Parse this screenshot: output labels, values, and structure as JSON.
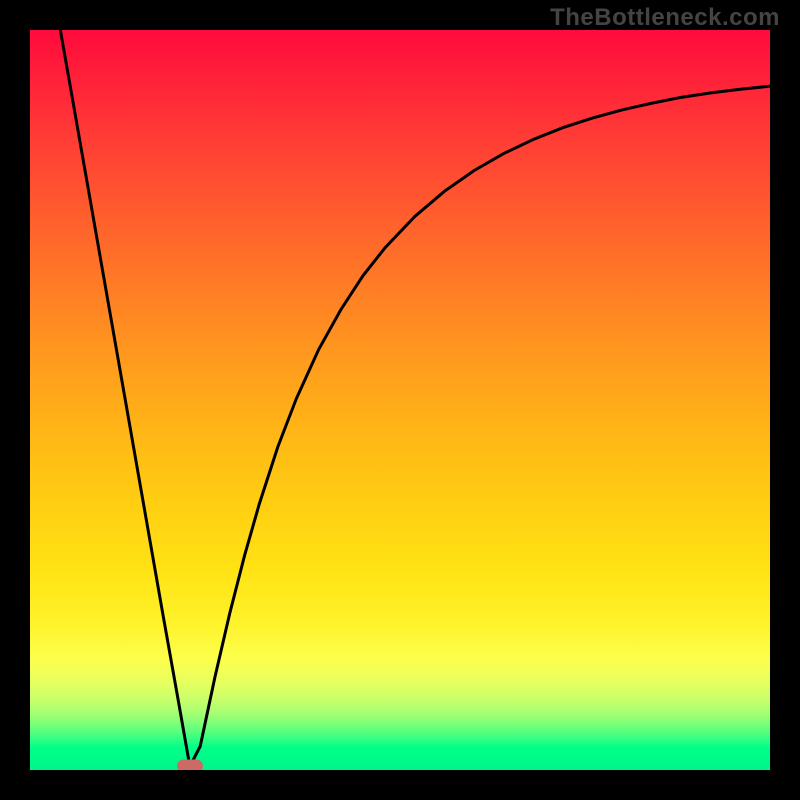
{
  "watermark": "TheBottleneck.com",
  "colors": {
    "page_bg": "#000000",
    "curve": "#000000",
    "marker": "#cc6b66",
    "watermark": "#444444"
  },
  "chart_data": {
    "type": "line",
    "title": "",
    "xlabel": "",
    "ylabel": "",
    "xlim": [
      0,
      100
    ],
    "ylim": [
      0,
      100
    ],
    "grid": false,
    "legend": false,
    "series": [
      {
        "name": "bottleneck-curve",
        "x": [
          4.1,
          6,
          8,
          10,
          12,
          14,
          16,
          18,
          20,
          21.6,
          23,
          25,
          27,
          29,
          31,
          33.5,
          36,
          39,
          42,
          45,
          48,
          52,
          56,
          60,
          64,
          68,
          72,
          76,
          80,
          84,
          88,
          92,
          96,
          100
        ],
        "values": [
          100,
          89.2,
          77.8,
          66.4,
          55,
          43.6,
          32.2,
          20.8,
          9.6,
          0.5,
          3.2,
          12.6,
          21.2,
          29,
          36,
          43.7,
          50.2,
          56.8,
          62.2,
          66.8,
          70.6,
          74.8,
          78.2,
          81,
          83.3,
          85.2,
          86.8,
          88.1,
          89.2,
          90.1,
          90.9,
          91.5,
          92,
          92.4
        ]
      }
    ],
    "marker": {
      "x": 21.6,
      "y": 0.5
    },
    "background_gradient": {
      "direction": "top-to-bottom",
      "stops": [
        {
          "pos": 0.0,
          "color": "#ff0a3c"
        },
        {
          "pos": 0.24,
          "color": "#ff5a2e"
        },
        {
          "pos": 0.54,
          "color": "#ffb516"
        },
        {
          "pos": 0.8,
          "color": "#fff22a"
        },
        {
          "pos": 0.92,
          "color": "#a0ff72"
        },
        {
          "pos": 1.0,
          "color": "#00f58c"
        }
      ]
    }
  }
}
